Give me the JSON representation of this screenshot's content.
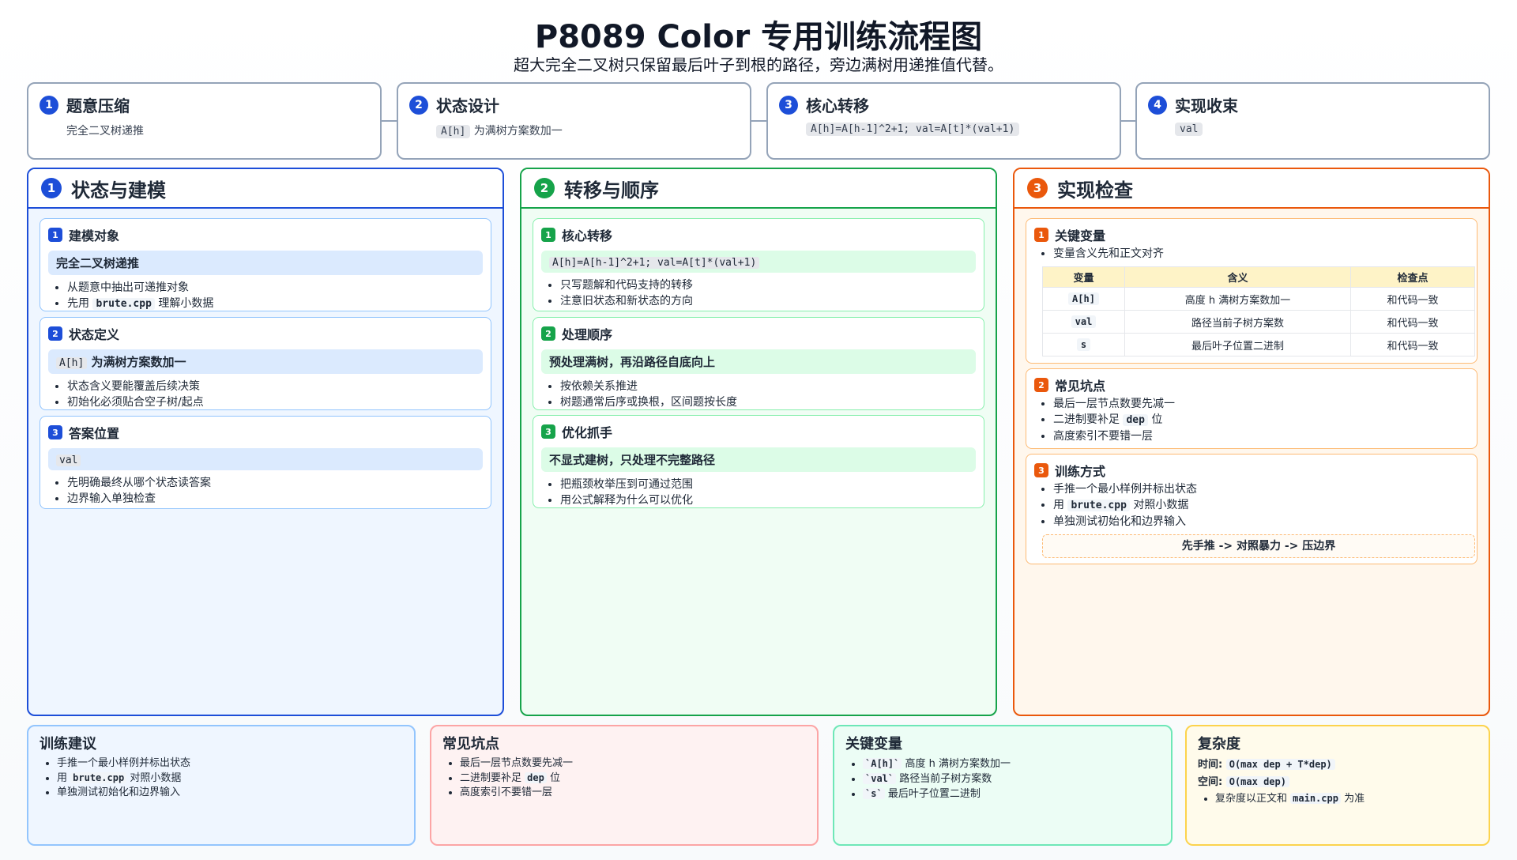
{
  "title": "P8089 Color 专用训练流程图",
  "subtitle": "超大完全二叉树只保留最后叶子到根的路径，旁边满树用递推值代替。",
  "steps": [
    {
      "num": "1",
      "title": "题意压缩",
      "desc": "完全二叉树递推"
    },
    {
      "num": "2",
      "title": "状态设计",
      "code": "A[h]",
      "desc": "为满树方案数加一"
    },
    {
      "num": "3",
      "title": "核心转移",
      "code": "A[h]=A[h-1]^2+1; val=A[t]*(val+1)"
    },
    {
      "num": "4",
      "title": "实现收束",
      "code": "val"
    }
  ],
  "columns": {
    "model": {
      "num": "1",
      "title": "状态与建模",
      "cards": [
        {
          "num": "1",
          "title": "建模对象",
          "highlight": "完全二叉树递推",
          "b1": "从题意中抽出可递推对象",
          "b2_pre": "先用",
          "b2_code": "brute.cpp",
          "b2_post": "理解小数据"
        },
        {
          "num": "2",
          "title": "状态定义",
          "hl_code": "A[h]",
          "highlight": "为满树方案数加一",
          "b1": "状态含义要能覆盖后续决策",
          "b2": "初始化必须贴合空子树/起点"
        },
        {
          "num": "3",
          "title": "答案位置",
          "hl_code": "val",
          "b1": "先明确最终从哪个状态读答案",
          "b2": "边界输入单独检查"
        }
      ]
    },
    "transfer": {
      "num": "2",
      "title": "转移与顺序",
      "cards": [
        {
          "num": "1",
          "title": "核心转移",
          "hl_code": "A[h]=A[h-1]^2+1; val=A[t]*(val+1)",
          "b1": "只写题解和代码支持的转移",
          "b2": "注意旧状态和新状态的方向"
        },
        {
          "num": "2",
          "title": "处理顺序",
          "highlight": "预处理满树，再沿路径自底向上",
          "b1": "按依赖关系推进",
          "b2": "树题通常后序或换根，区间题按长度"
        },
        {
          "num": "3",
          "title": "优化抓手",
          "highlight": "不显式建树，只处理不完整路径",
          "b1": "把瓶颈枚举压到可通过范围",
          "b2": "用公式解释为什么可以优化"
        }
      ]
    },
    "impl": {
      "num": "3",
      "title": "实现检查",
      "vars_card": {
        "num": "1",
        "title": "关键变量",
        "b1": "变量含义先和正文对齐",
        "headers": [
          "变量",
          "含义",
          "检查点"
        ],
        "rows": [
          {
            "var": "A[h]",
            "meaning": "高度 h 满树方案数加一",
            "check": "和代码一致"
          },
          {
            "var": "val",
            "meaning": "路径当前子树方案数",
            "check": "和代码一致"
          },
          {
            "var": "s",
            "meaning": "最后叶子位置二进制",
            "check": "和代码一致"
          }
        ]
      },
      "pitfalls_card": {
        "num": "2",
        "title": "常见坑点",
        "b1": "最后一层节点数要先减一",
        "b2_pre": "二进制要补足",
        "b2_code": "dep",
        "b2_post": "位",
        "b3": "高度索引不要错一层"
      },
      "training_card": {
        "num": "3",
        "title": "训练方式",
        "b1": "手推一个最小样例并标出状态",
        "b2_pre": "用",
        "b2_code": "brute.cpp",
        "b2_post": "对照小数据",
        "b3": "单独测试初始化和边界输入",
        "flow": "先手推 -> 对照暴力 -> 压边界"
      }
    }
  },
  "bottom": {
    "training": {
      "title": "训练建议",
      "b1": "手推一个最小样例并标出状态",
      "b2_pre": "用",
      "b2_code": "brute.cpp",
      "b2_post": "对照小数据",
      "b3": "单独测试初始化和边界输入"
    },
    "pitfalls": {
      "title": "常见坑点",
      "b1": "最后一层节点数要先减一",
      "b2_pre": "二进制要补足",
      "b2_code": "dep",
      "b2_post": "位",
      "b3": "高度索引不要错一层"
    },
    "vars": {
      "title": "关键变量",
      "v1": "`A[h]`",
      "d1": "高度 h 满树方案数加一",
      "v2": "`val`",
      "d2": "路径当前子树方案数",
      "v3": "`s`",
      "d3": "最后叶子位置二进制"
    },
    "complexity": {
      "title": "复杂度",
      "time_label": "时间:",
      "time": "O(max dep + T*dep)",
      "space_label": "空间:",
      "space": "O(max dep)",
      "note_pre": "复杂度以正文和",
      "note_code": "main.cpp",
      "note_post": "为准"
    }
  },
  "colors": {
    "blue": "#1d4ed8",
    "green": "#16a34a",
    "orange": "#ea580c"
  }
}
